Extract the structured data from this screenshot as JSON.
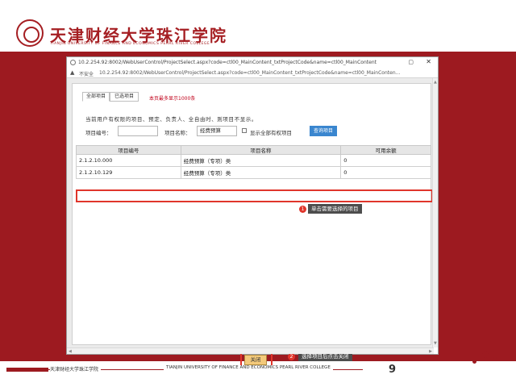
{
  "header": {
    "title": "天津财经大学珠江学院",
    "subtitle": "TIANJIN UNIVERSITY OF FINANCE AND ECONOMICS PEARL RIVER COLLEGE"
  },
  "browser": {
    "title": "10.2.254.92:8002/WebUserControl/ProjectSelect.aspx?code=ctl00_MainContent_txtProjectCode&name=ctl00_MainContent_txtProject...",
    "insecure_label": "不安全",
    "address": "10.2.254.92:8002/WebUserControl/ProjectSelect.aspx?code=ctl00_MainContent_txtProjectCode&name=ctl00_MainConten..."
  },
  "tabs": [
    {
      "label": "全部项目"
    },
    {
      "label": "已选项目"
    }
  ],
  "tab_note": "本页最多显示1000条",
  "hint": "当前用户有权限的项目、预定、负责人、全自由时、则项目不显示。",
  "search": {
    "code_label": "项目编号：",
    "code_value": "",
    "name_label": "项目名称：",
    "name_value": "经费预算",
    "checkbox_label": "显示全部有权项目",
    "query_button": "查询项目"
  },
  "table": {
    "columns": [
      "项目编号",
      "项目名称",
      "可用余额"
    ],
    "rows": [
      [
        "2.1.2.10.000",
        "经费预算（专项）类",
        "0"
      ],
      [
        "2.1.2.10.129",
        "经费预算（专项）类",
        "0"
      ]
    ]
  },
  "callouts": {
    "c1_num": "1",
    "c1_text": "单击需要选择的项目",
    "c2_num": "2",
    "c2_text": "选择项目后点击关闭"
  },
  "ok_button": "关闭",
  "footer": {
    "cn": "天津财经大学珠江学院",
    "en": "TIANJIN UNIVERSITY OF FINANCE AND ECONOMICS PEARL RIVER COLLEGE",
    "page": "9"
  },
  "colors": {
    "brand_red": "#9d1a20",
    "highlight": "#e0352b",
    "query_blue": "#3a86cf"
  }
}
